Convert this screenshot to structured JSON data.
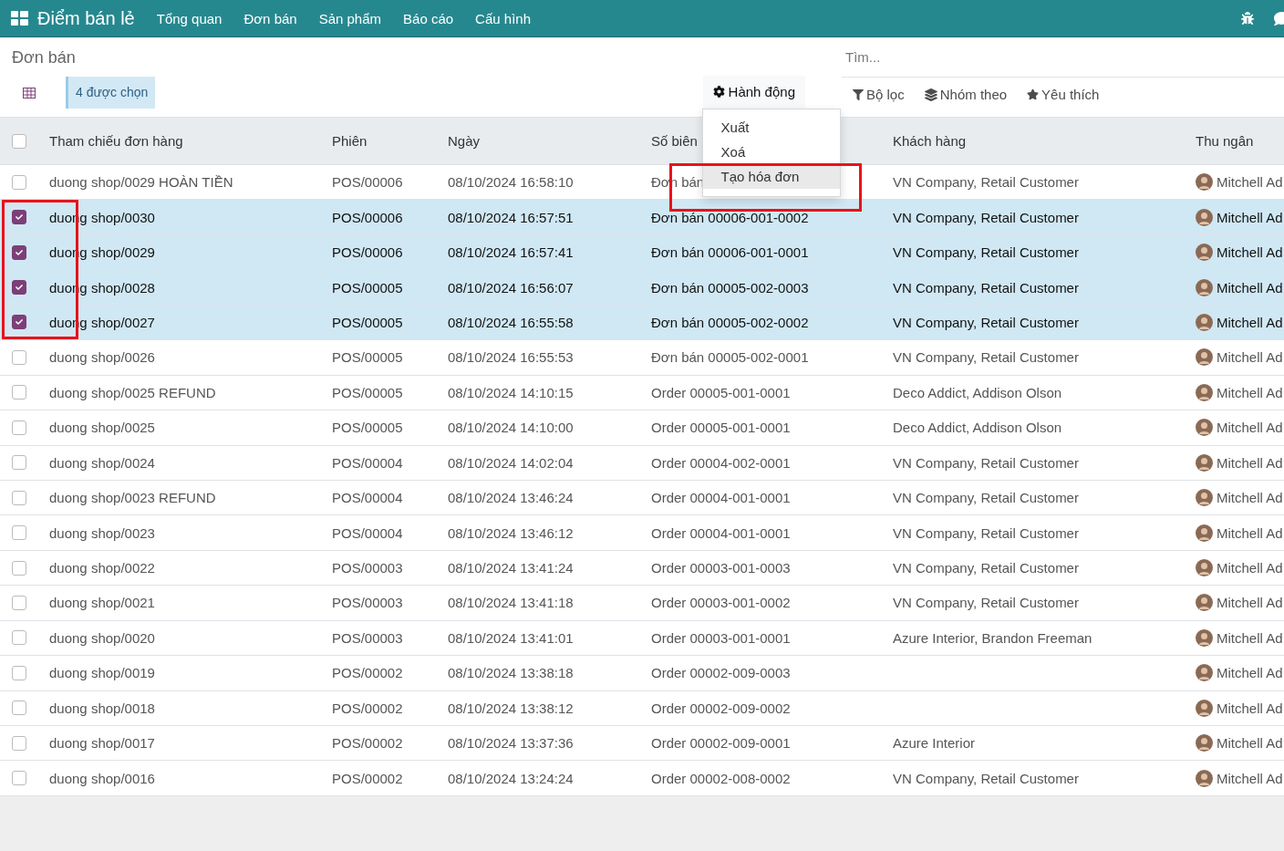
{
  "app": {
    "name": "Điểm bán lẻ",
    "menu": [
      "Tổng quan",
      "Đơn bán",
      "Sản phẩm",
      "Báo cáo",
      "Cấu hình"
    ]
  },
  "breadcrumb": "Đơn bán",
  "selection_badge": "4 được chọn",
  "action_menu": {
    "label": "Hành động",
    "expanded": true,
    "items": [
      {
        "label": "Xuất",
        "selected": false
      },
      {
        "label": "Xoá",
        "selected": false
      },
      {
        "label": "Tạo hóa đơn",
        "selected": true
      }
    ]
  },
  "search": {
    "placeholder": "Tìm..."
  },
  "search_options": [
    {
      "kind": "filter",
      "label": "Bộ lọc"
    },
    {
      "kind": "group",
      "label": "Nhóm theo"
    },
    {
      "kind": "favorite",
      "label": "Yêu thích"
    }
  ],
  "table": {
    "all_checked": false,
    "columns": [
      "Tham chiếu đơn hàng",
      "Phiên",
      "Ngày",
      "Số biên",
      "Khách hàng",
      "Thu ngân"
    ],
    "rows": [
      {
        "checked": false,
        "cells": [
          "duong shop/0029 HOÀN TIỀN",
          "POS/00006",
          "08/10/2024 16:58:10",
          "Đơn bán",
          "VN Company, Retail Customer",
          "Mitchell Ad"
        ]
      },
      {
        "checked": true,
        "cells": [
          "duong shop/0030",
          "POS/00006",
          "08/10/2024 16:57:51",
          "Đơn bán 00006-001-0002",
          "VN Company, Retail Customer",
          "Mitchell Ad"
        ]
      },
      {
        "checked": true,
        "cells": [
          "duong shop/0029",
          "POS/00006",
          "08/10/2024 16:57:41",
          "Đơn bán 00006-001-0001",
          "VN Company, Retail Customer",
          "Mitchell Ad"
        ]
      },
      {
        "checked": true,
        "cells": [
          "duong shop/0028",
          "POS/00005",
          "08/10/2024 16:56:07",
          "Đơn bán 00005-002-0003",
          "VN Company, Retail Customer",
          "Mitchell Ad"
        ]
      },
      {
        "checked": true,
        "cells": [
          "duong shop/0027",
          "POS/00005",
          "08/10/2024 16:55:58",
          "Đơn bán 00005-002-0002",
          "VN Company, Retail Customer",
          "Mitchell Ad"
        ]
      },
      {
        "checked": false,
        "cells": [
          "duong shop/0026",
          "POS/00005",
          "08/10/2024 16:55:53",
          "Đơn bán 00005-002-0001",
          "VN Company, Retail Customer",
          "Mitchell Ad"
        ]
      },
      {
        "checked": false,
        "cells": [
          "duong shop/0025 REFUND",
          "POS/00005",
          "08/10/2024 14:10:15",
          "Order 00005-001-0001",
          "Deco Addict, Addison Olson",
          "Mitchell Ad"
        ]
      },
      {
        "checked": false,
        "cells": [
          "duong shop/0025",
          "POS/00005",
          "08/10/2024 14:10:00",
          "Order 00005-001-0001",
          "Deco Addict, Addison Olson",
          "Mitchell Ad"
        ]
      },
      {
        "checked": false,
        "cells": [
          "duong shop/0024",
          "POS/00004",
          "08/10/2024 14:02:04",
          "Order 00004-002-0001",
          "VN Company, Retail Customer",
          "Mitchell Ad"
        ]
      },
      {
        "checked": false,
        "cells": [
          "duong shop/0023 REFUND",
          "POS/00004",
          "08/10/2024 13:46:24",
          "Order 00004-001-0001",
          "VN Company, Retail Customer",
          "Mitchell Ad"
        ]
      },
      {
        "checked": false,
        "cells": [
          "duong shop/0023",
          "POS/00004",
          "08/10/2024 13:46:12",
          "Order 00004-001-0001",
          "VN Company, Retail Customer",
          "Mitchell Ad"
        ]
      },
      {
        "checked": false,
        "cells": [
          "duong shop/0022",
          "POS/00003",
          "08/10/2024 13:41:24",
          "Order 00003-001-0003",
          "VN Company, Retail Customer",
          "Mitchell Ad"
        ]
      },
      {
        "checked": false,
        "cells": [
          "duong shop/0021",
          "POS/00003",
          "08/10/2024 13:41:18",
          "Order 00003-001-0002",
          "VN Company, Retail Customer",
          "Mitchell Ad"
        ]
      },
      {
        "checked": false,
        "cells": [
          "duong shop/0020",
          "POS/00003",
          "08/10/2024 13:41:01",
          "Order 00003-001-0001",
          "Azure Interior, Brandon Freeman",
          "Mitchell Ad"
        ]
      },
      {
        "checked": false,
        "cells": [
          "duong shop/0019",
          "POS/00002",
          "08/10/2024 13:38:18",
          "Order 00002-009-0003",
          null,
          "Mitchell Ad"
        ]
      },
      {
        "checked": false,
        "cells": [
          "duong shop/0018",
          "POS/00002",
          "08/10/2024 13:38:12",
          "Order 00002-009-0002",
          null,
          "Mitchell Ad"
        ]
      },
      {
        "checked": false,
        "cells": [
          "duong shop/0017",
          "POS/00002",
          "08/10/2024 13:37:36",
          "Order 00002-009-0001",
          "Azure Interior",
          "Mitchell Ad"
        ]
      },
      {
        "checked": false,
        "cells": [
          "duong shop/0016",
          "POS/00002",
          "08/10/2024 13:24:24",
          "Order 00002-008-0002",
          "VN Company, Retail Customer",
          "Mitchell Ad"
        ]
      }
    ]
  },
  "highlights": {
    "checkbox_column": true,
    "menu_item": true
  }
}
